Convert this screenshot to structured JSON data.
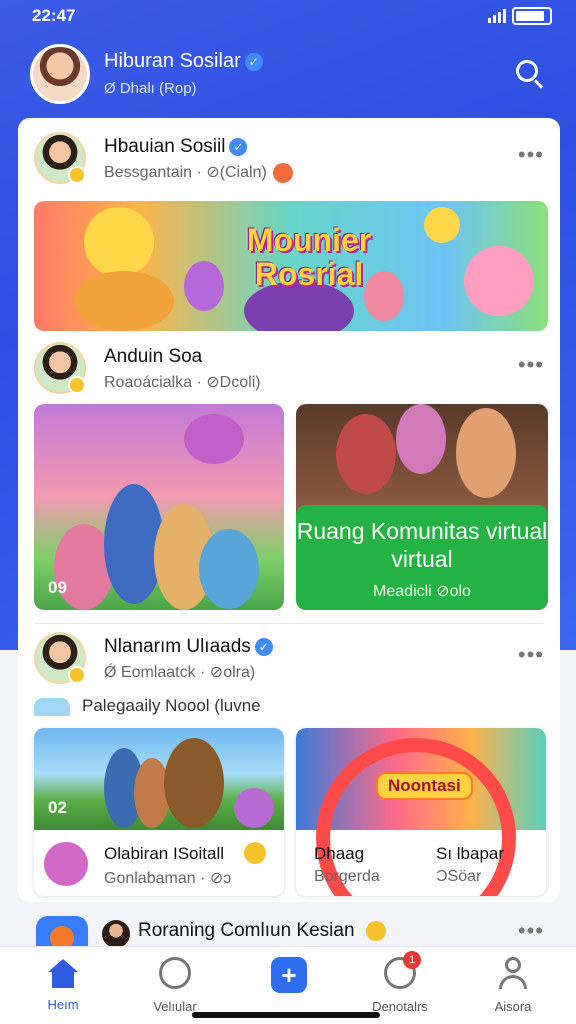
{
  "status": {
    "time": "22:47"
  },
  "header": {
    "title": "Hiburan Sosilar",
    "subtitle": "Ø Dhalı (Rop)"
  },
  "posts": [
    {
      "name": "Hbauian Sosiil",
      "meta": "Bessgantain · ⊘(Cialn)",
      "banner_title": "Mounier Rosrial"
    },
    {
      "name": "Anduin Soa",
      "meta": "Roaoácialka · ⊘Dcoli)",
      "photo_count": "09",
      "community_title": "Ruang Komunitas virtual virtual",
      "community_sub": "Meadicli ⊘olo"
    },
    {
      "name": "Nlanarım Ulıaads",
      "meta": "Ǿ Eomlaatck · ⊘olra)",
      "sub_line": "Palegaaily Noool (luvne",
      "cards": [
        {
          "count": "02",
          "title": "Olabiran ISoitall",
          "sub": "Gonlabaman · ⊘ↄ"
        },
        {
          "label": "Noontasi",
          "title_left": "Dhaag",
          "sub_left": "Borgerda",
          "title_right": "Sı lbapar",
          "sub_right": "ƆSöar"
        }
      ]
    }
  ],
  "next_post": {
    "title": "Roraning Comlıun Kesian"
  },
  "tabs": [
    {
      "label": "Heım",
      "icon": "home-icon"
    },
    {
      "label": "Velıular",
      "icon": "explore-icon"
    },
    {
      "label": "",
      "icon": "create-icon"
    },
    {
      "label": "Denotalrs",
      "icon": "notifications-icon",
      "badge": "1"
    },
    {
      "label": "Aisora",
      "icon": "profile-icon"
    }
  ],
  "colors": {
    "accent": "#2f5ce0",
    "community": "#25b244",
    "notification": "#e53935"
  }
}
